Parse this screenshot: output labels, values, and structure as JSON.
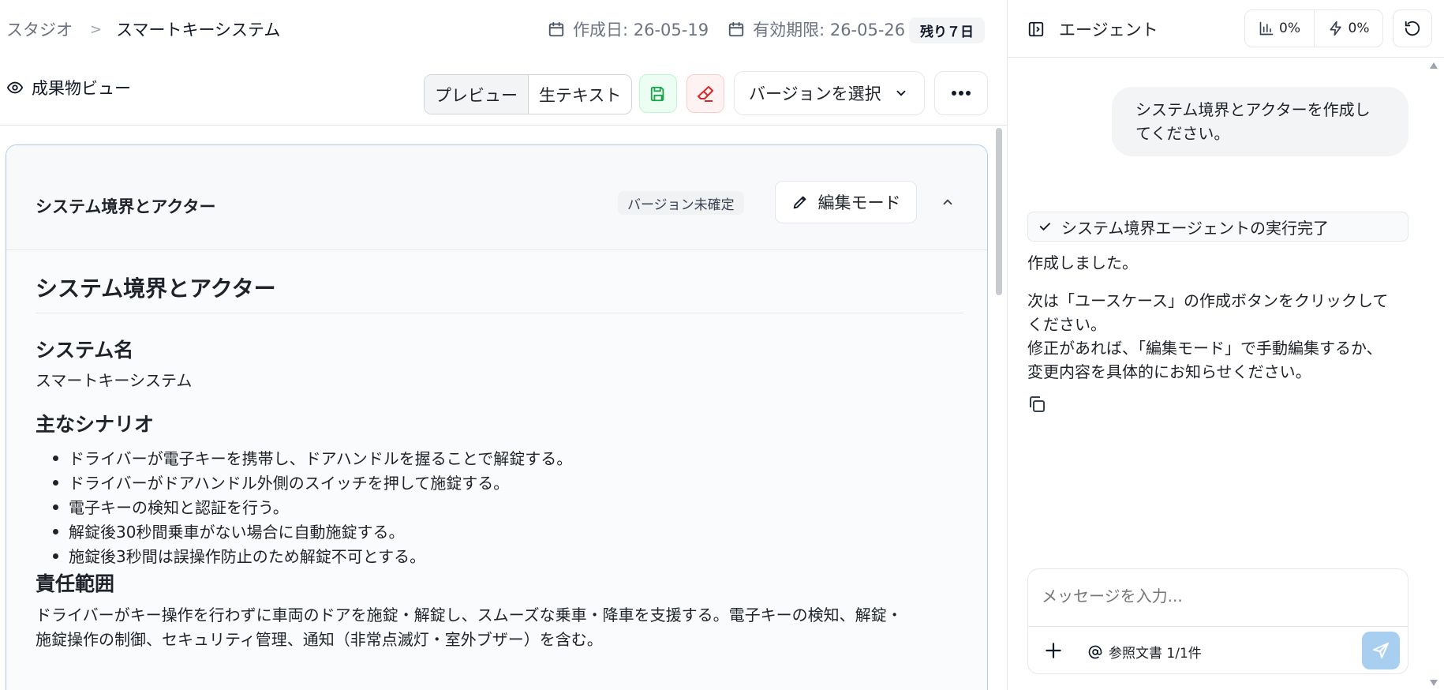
{
  "breadcrumb": {
    "studio": "スタジオ",
    "separator": ">",
    "current": "スマートキーシステム"
  },
  "dates": {
    "created": "作成日: 26-05-19",
    "expires": "有効期限: 26-05-26"
  },
  "remaining": "残り７日",
  "toolbar": {
    "view_label": "成果物ビュー",
    "preview": "プレビュー",
    "raw_text": "生テキスト",
    "version_select": "バージョンを選択"
  },
  "card": {
    "title": "システム境界とアクター",
    "status_badge": "バージョン未確定",
    "edit_button": "編集モード"
  },
  "document": {
    "h1": "システム境界とアクター",
    "sections": [
      {
        "heading": "システム名",
        "body": "スマートキーシステム"
      },
      {
        "heading": "主なシナリオ",
        "items": [
          "ドライバーが電子キーを携帯し、ドアハンドルを握ることで解錠する。",
          "ドライバーがドアハンドル外側のスイッチを押して施錠する。",
          "電子キーの検知と認証を行う。",
          "解錠後30秒間乗車がない場合に自動施錠する。",
          "施錠後3秒間は誤操作防止のため解錠不可とする。"
        ]
      },
      {
        "heading": "責任範囲",
        "body": "ドライバーがキー操作を行わずに車両のドアを施錠・解錠し、スムーズな乗車・降車を支援する。電子キーの検知、解錠・",
        "body2": "施錠操作の制御、セキュリティ管理、通知（非常点滅灯・室外ブザー）を含む。"
      }
    ]
  },
  "agent": {
    "title": "エージェント",
    "stat_chart": "0%",
    "stat_bolt": "0%",
    "user_message_line1": "システム境界とアクターを作成し",
    "user_message_line2": "てください。",
    "status": "システム境界エージェントの実行完了",
    "reply": [
      "作成しました。",
      "次は「ユースケース」の作成ボタンをクリックして",
      "ください。",
      "修正があれば、「編集モード」で手動編集するか、",
      "変更内容を具体的にお知らせください。"
    ],
    "input_placeholder": "メッセージを入力...",
    "reference_docs": "参照文書 1/1件"
  },
  "colors": {
    "accent": "#a8cdf0",
    "save_green": "#16a34a",
    "erase_red": "#dc2626"
  }
}
